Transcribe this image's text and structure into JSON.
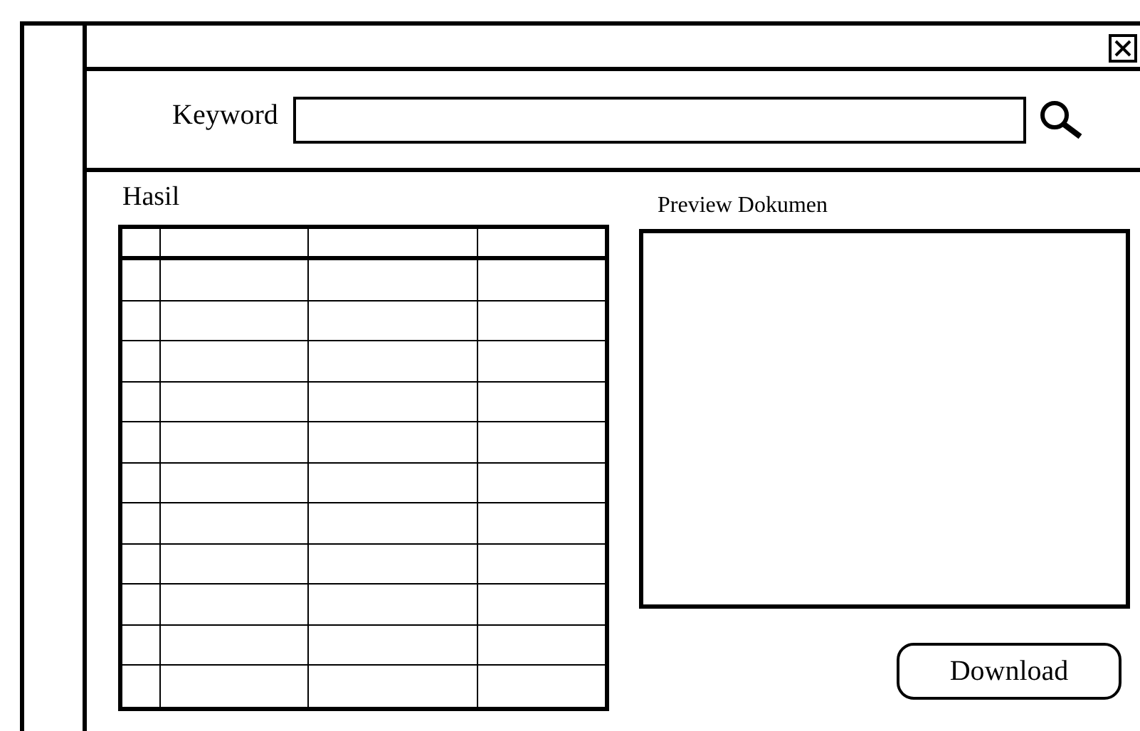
{
  "search": {
    "label": "Keyword"
  },
  "results": {
    "title": "Hasil"
  },
  "preview": {
    "title": "Preview Dokumen"
  },
  "buttons": [
    {
      "label": "Download"
    }
  ]
}
